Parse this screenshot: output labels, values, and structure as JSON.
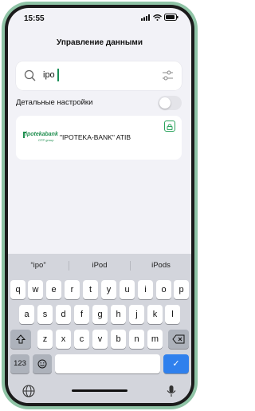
{
  "status": {
    "time": "15:55"
  },
  "title": "Управление данными",
  "search": {
    "value": "ipo"
  },
  "detailed_settings_label": "Детальные настройки",
  "result": {
    "logo_text": "ipotekabank",
    "logo_sub": "OTP group",
    "name": "\"IPOTEKA-BANK\" ATIB"
  },
  "keyboard": {
    "suggestions": [
      "“ipo”",
      "iPod",
      "iPods"
    ],
    "row1": [
      "q",
      "w",
      "e",
      "r",
      "t",
      "y",
      "u",
      "i",
      "o",
      "p"
    ],
    "row2": [
      "a",
      "s",
      "d",
      "f",
      "g",
      "h",
      "j",
      "k",
      "l"
    ],
    "row3": [
      "z",
      "x",
      "c",
      "v",
      "b",
      "n",
      "m"
    ],
    "numbers_key": "123",
    "return_key": "✓"
  },
  "colors": {
    "accent": "#2f80ed",
    "brand_green": "#1f8e4f",
    "phone_frame": "#8fc4a6"
  }
}
